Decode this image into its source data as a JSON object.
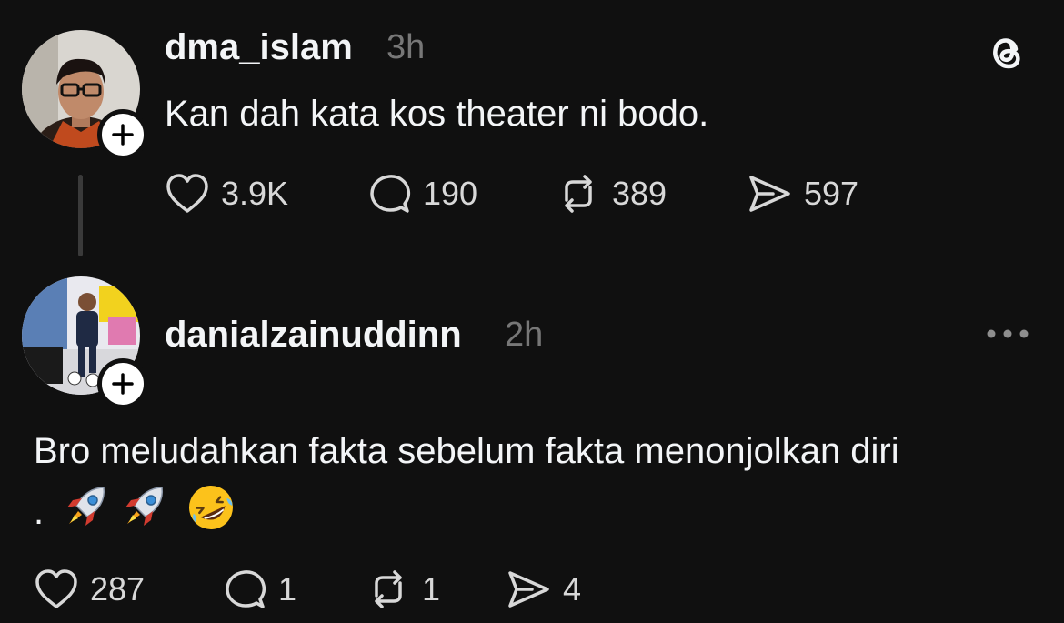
{
  "post1": {
    "username": "dma_islam",
    "time": "3h",
    "text": "Kan dah kata kos theater ni bodo.",
    "avatar_icon": "person-with-glasses-avatar",
    "follow_icon": "plus-icon",
    "app_icon": "threads-logo-icon",
    "actions": {
      "likes": "3.9K",
      "comments": "190",
      "reposts": "389",
      "shares": "597"
    }
  },
  "post2": {
    "username": "danialzainuddinn",
    "time": "2h",
    "text_line1": "Bro meludahkan fakta sebelum fakta menonjolkan diri",
    "text_line2_prefix": ".",
    "emojis": [
      "rocket-emoji",
      "rocket-emoji",
      "rolling-laughing-emoji"
    ],
    "avatar_icon": "football-player-avatar",
    "follow_icon": "plus-icon",
    "menu_icon": "more-dots-icon",
    "actions": {
      "likes": "287",
      "comments": "1",
      "reposts": "1",
      "shares": "4"
    }
  },
  "colors": {
    "background": "#101010",
    "text_primary": "#f3f5f7",
    "text_secondary": "#777777"
  }
}
